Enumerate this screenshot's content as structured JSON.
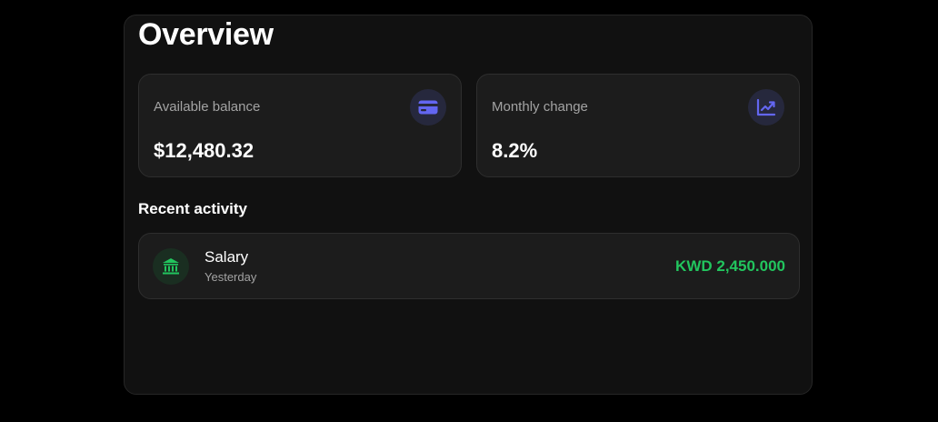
{
  "overview": {
    "title": "Overview"
  },
  "stats": [
    {
      "label": "Available balance",
      "value": "$12,480.32",
      "icon": "credit-card-icon"
    },
    {
      "label": "Monthly change",
      "value": "8.2%",
      "icon": "trending-up-chart-icon"
    }
  ],
  "recent_activity": {
    "title": "Recent activity",
    "items": [
      {
        "title": "Salary",
        "subtitle": "Yesterday",
        "amount": "KWD 2,450.000",
        "icon": "bank-icon"
      }
    ]
  },
  "colors": {
    "background": "#000000",
    "panel": "#111111",
    "card": "#1c1c1c",
    "accent_indigo": "#6366f1",
    "positive_green": "#22c55e"
  }
}
